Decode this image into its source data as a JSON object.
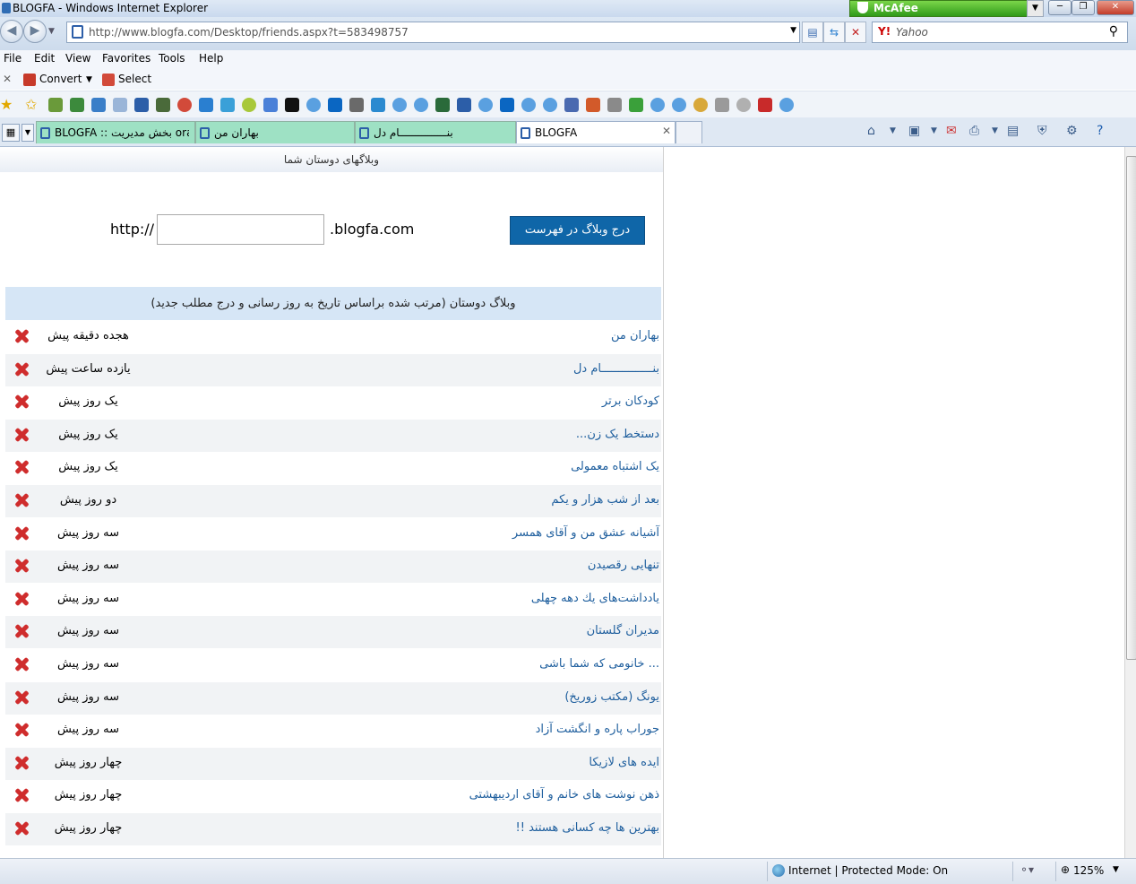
{
  "window": {
    "title": "BLOGFA - Windows Internet Explorer",
    "mcafee": "McAfee"
  },
  "address": {
    "url": "http://www.blogfa.com/Desktop/friends.aspx?t=583498757",
    "search_placeholder": "Yahoo"
  },
  "menu": {
    "items": [
      "File",
      "Edit",
      "View",
      "Favorites",
      "Tools",
      "Help"
    ]
  },
  "convert_bar": {
    "convert_label": "Convert",
    "select_label": "Select"
  },
  "tabs": [
    {
      "label": "BLOGFA :: بخش مدیریت oran..."
    },
    {
      "label": "بهاران من"
    },
    {
      "label": "بنـــــــــــــــام دل"
    },
    {
      "label": "BLOGFA"
    }
  ],
  "page": {
    "header": "وبلاگهای دوستان شما",
    "http_label": "http://",
    "domain_suffix": ".blogfa.com",
    "input_value": "",
    "add_button": "درج وبلاگ در فهرست",
    "list_title": "وبلاگ دوستان (مرتب شده براساس تاریخ به روز رسانی و درج مطلب جدید)",
    "friends": [
      {
        "name": "بهاران من",
        "time": "هجده دقیقه پیش"
      },
      {
        "name": "بنـــــــــــــــام دل",
        "time": "یازده ساعت پیش"
      },
      {
        "name": "کودکان برتر",
        "time": "یک روز پیش"
      },
      {
        "name": "دستخط یک زن...",
        "time": "یک روز پیش"
      },
      {
        "name": "یک اشتباه معمولی",
        "time": "یک روز پیش"
      },
      {
        "name": "بعد از شب هزار و یکم",
        "time": "دو روز پیش"
      },
      {
        "name": "آشیانه عشق من و آقای همسر",
        "time": "سه روز پیش"
      },
      {
        "name": "تنهایی رقصیدن",
        "time": "سه روز پیش"
      },
      {
        "name": "یادداشت‌های یك دهه چهلی",
        "time": "سه روز پیش"
      },
      {
        "name": "مدیران گلستان",
        "time": "سه روز پیش"
      },
      {
        "name": "... خانومی که شما باشی",
        "time": "سه روز پیش"
      },
      {
        "name": "یونگ (مکتب زوریخ)",
        "time": "سه روز پیش"
      },
      {
        "name": "جوراب پاره و انگشت آزاد",
        "time": "سه روز پیش"
      },
      {
        "name": "ایده های لازیکا",
        "time": "چهار روز پیش"
      },
      {
        "name": "ذهن نوشت های خانم و آقای اردیبهشتی",
        "time": "چهار روز پیش"
      },
      {
        "name": "بهترین ها چه کسانی هستند !!",
        "time": "چهار روز پیش"
      }
    ]
  },
  "status": {
    "zone": "Internet | Protected Mode: On",
    "zoom": "125%"
  }
}
